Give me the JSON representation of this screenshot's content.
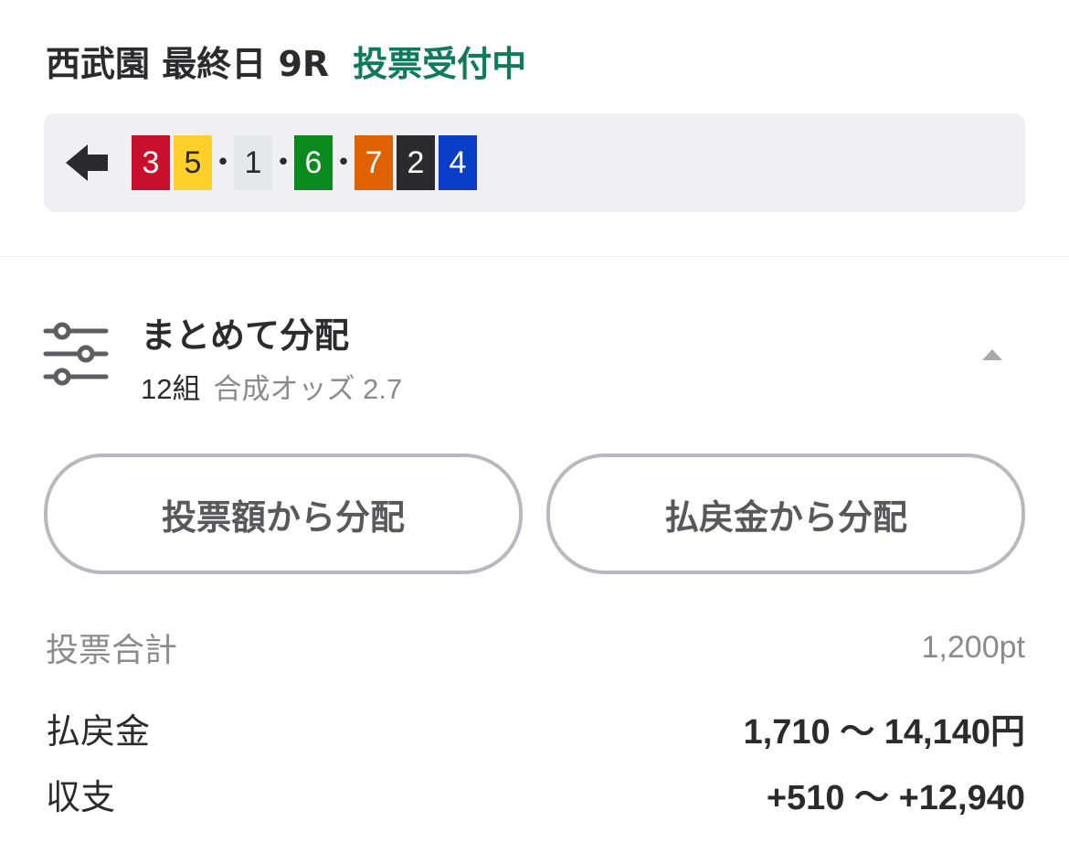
{
  "header": {
    "race": "西武園 最終日 9R",
    "status": "投票受付中"
  },
  "colors": {
    "status_green": "#0f7a5c",
    "box_bg": "#f0f0f3",
    "muted_text": "#8a8a8f",
    "button_border": "#b8b9bf"
  },
  "combination": {
    "direction_icon": "arrow-left-icon",
    "items": [
      {
        "number": "3",
        "bg": "#c8102e",
        "fg": "#ffffff",
        "sep": ""
      },
      {
        "number": "5",
        "bg": "#ffd02a",
        "fg": "#2b2b2d",
        "sep": "•"
      },
      {
        "number": "1",
        "bg": "#e6e7ea",
        "fg": "#2b2b2d",
        "sep": "•"
      },
      {
        "number": "6",
        "bg": "#0a8a1e",
        "fg": "#ffffff",
        "sep": "•"
      },
      {
        "number": "7",
        "bg": "#e06100",
        "fg": "#ffffff",
        "sep": ""
      },
      {
        "number": "2",
        "bg": "#2b2b2d",
        "fg": "#ffffff",
        "sep": ""
      },
      {
        "number": "4",
        "bg": "#0a3ec8",
        "fg": "#ffffff",
        "sep": ""
      }
    ]
  },
  "distribution": {
    "icon": "sliders-icon",
    "title": "まとめて分配",
    "count": "12組",
    "odds": "合成オッズ 2.7",
    "collapse_icon": "chevron-up-icon"
  },
  "buttons": {
    "by_stake": "投票額から分配",
    "by_payout": "払戻金から分配"
  },
  "summary": {
    "total_label": "投票合計",
    "total_value": "1,200pt",
    "payout_label": "払戻金",
    "payout_value": "1,710 〜 14,140円",
    "balance_label": "収支",
    "balance_value": "+510 〜 +12,940"
  }
}
